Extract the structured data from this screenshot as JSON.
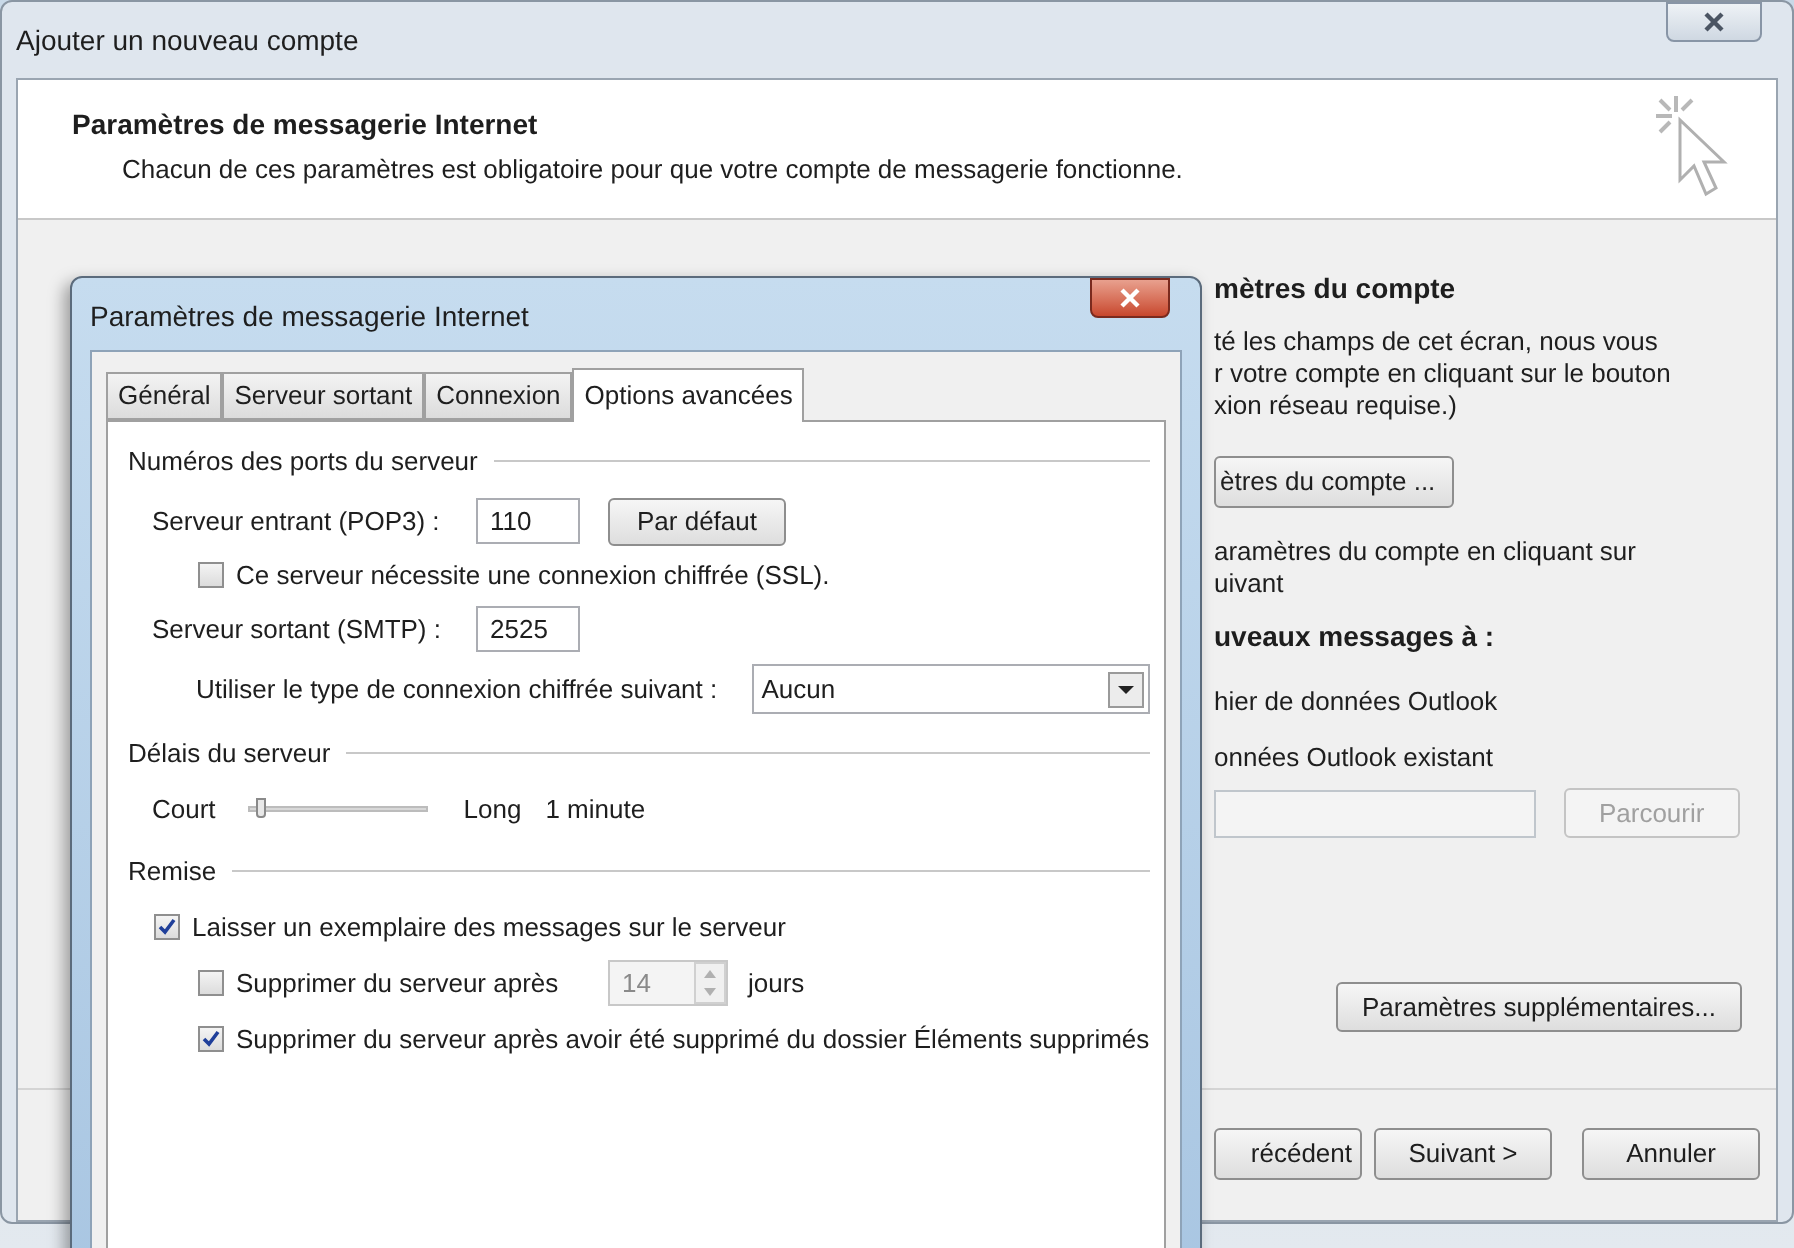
{
  "window": {
    "title": "Ajouter un nouveau compte"
  },
  "header": {
    "title": "Paramètres de messagerie Internet",
    "subtitle": "Chacun de ces paramètres est obligatoire pour que votre compte de messagerie fonctionne."
  },
  "background_panel": {
    "heading": "mètres du compte",
    "lines": [
      "té les champs de cet écran, nous vous",
      "r votre compte en cliquant sur le bouton",
      "xion réseau requise.)"
    ],
    "test_button": "ètres du compte ...",
    "note_lines": [
      "aramètres du compte en cliquant sur",
      "uivant"
    ],
    "delivery_heading": "uveaux messages à :",
    "options": [
      "hier de données Outlook",
      "onnées Outlook existant"
    ],
    "browse_button": {
      "label": "Parcourir",
      "disabled": true
    },
    "more_settings_button": "Paramètres supplémentaires..."
  },
  "footer_buttons": [
    "récédent",
    "Suivant >",
    "Annuler"
  ],
  "dialog": {
    "title": "Paramètres de messagerie Internet",
    "tabs": [
      {
        "label": "Général",
        "selected": false
      },
      {
        "label": "Serveur sortant",
        "selected": false
      },
      {
        "label": "Connexion",
        "selected": false
      },
      {
        "label": "Options avancées",
        "selected": true
      }
    ],
    "ports": {
      "heading": "Numéros des ports du serveur",
      "incoming": {
        "label": "Serveur entrant (POP3) :",
        "value": "110"
      },
      "default_button": "Par défaut",
      "ssl": {
        "label": "Ce serveur nécessite une connexion chiffrée (SSL).",
        "checked": false
      },
      "outgoing": {
        "label": "Serveur sortant (SMTP) :",
        "value": "2525"
      },
      "encryption": {
        "label": "Utiliser le type de connexion chiffrée suivant :",
        "value": "Aucun"
      }
    },
    "timeout": {
      "heading": "Délais du serveur",
      "min_label": "Court",
      "max_label": "Long",
      "level": 0,
      "reading": "1 minute"
    },
    "delivery": {
      "heading": "Remise",
      "items": [
        {
          "kind": "checkbox",
          "label": "Laisser un exemplaire des messages sur le serveur",
          "checked": true
        },
        {
          "kind": "days",
          "label": "Supprimer du serveur après",
          "checked": false,
          "value": "14",
          "unit": "jours",
          "disabled": true
        },
        {
          "kind": "checkbox",
          "label": "Supprimer du serveur après avoir été supprimé du dossier Éléments supprimés",
          "checked": true
        }
      ]
    }
  }
}
